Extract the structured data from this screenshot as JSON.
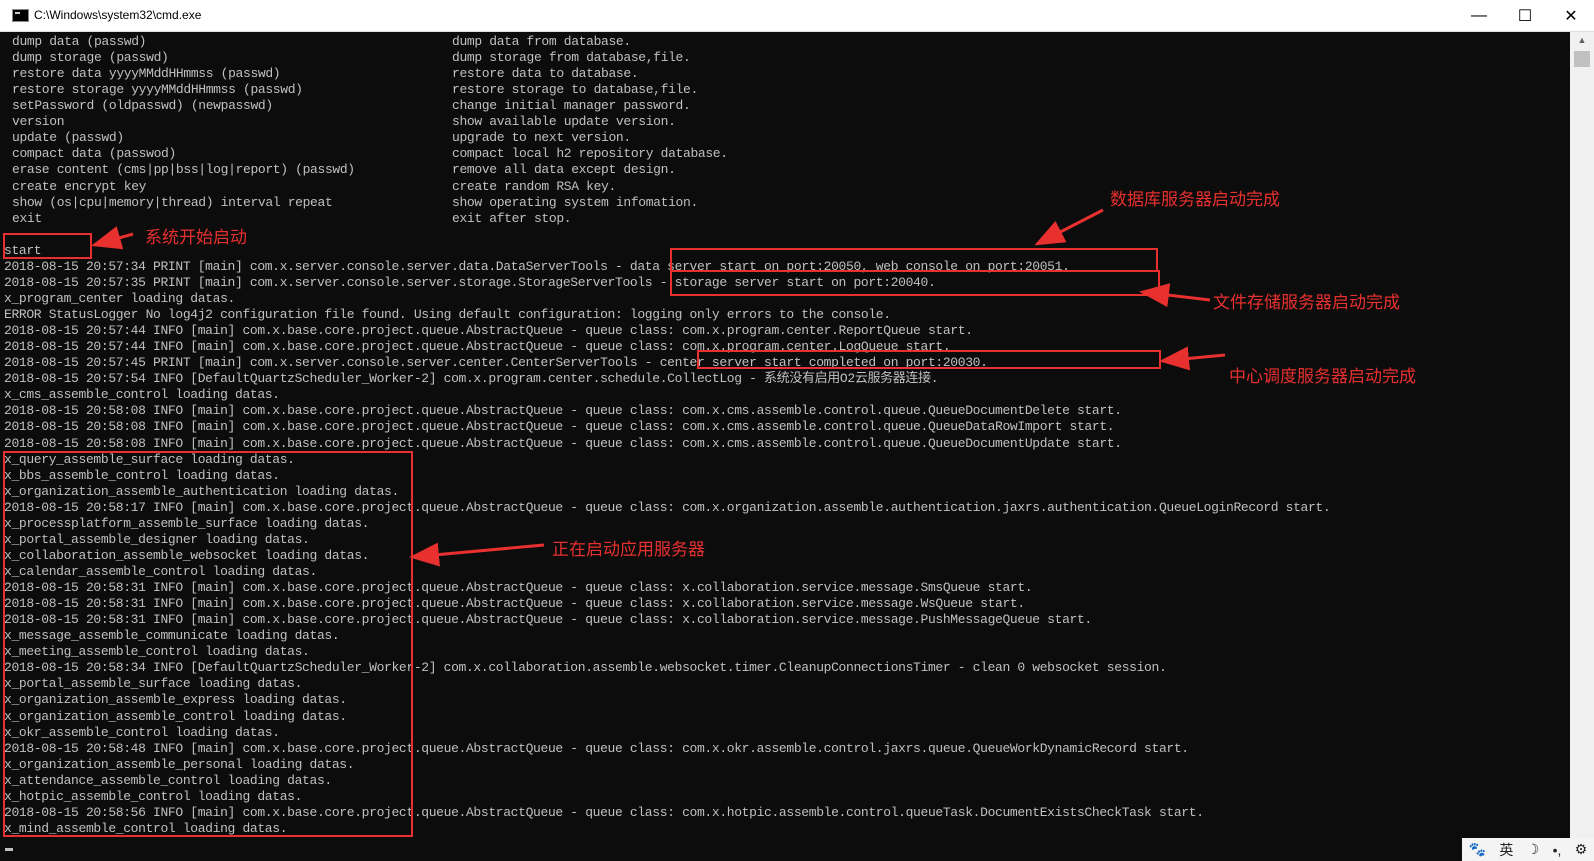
{
  "window": {
    "title": "C:\\Windows\\system32\\cmd.exe",
    "minimize": "—",
    "maximize": "☐",
    "close": "✕"
  },
  "help": [
    [
      "dump data (passwd)",
      "dump data from database."
    ],
    [
      "dump storage (passwd)",
      "dump storage from database,file."
    ],
    [
      "restore data yyyyMMddHHmmss (passwd)",
      "restore data to database."
    ],
    [
      "restore storage yyyyMMddHHmmss (passwd)",
      "restore storage to database,file."
    ],
    [
      "setPassword (oldpasswd) (newpasswd)",
      "change initial manager password."
    ],
    [
      "version",
      "show available update version."
    ],
    [
      "update (passwd)",
      "upgrade to next version."
    ],
    [
      "compact data (passwod)",
      "compact local h2 repository database."
    ],
    [
      "erase content (cms|pp|bss|log|report) (passwd)",
      "remove all data except design."
    ],
    [
      "create encrypt key",
      "create random RSA key."
    ],
    [
      "show (os|cpu|memory|thread) interval repeat",
      "show operating system infomation."
    ],
    [
      "exit",
      "exit after stop."
    ]
  ],
  "command": "start",
  "log": [
    "2018-08-15 20:57:34 PRINT [main] com.x.server.console.server.data.DataServerTools - data server start on port:20050, web console on port:20051.",
    "2018-08-15 20:57:35 PRINT [main] com.x.server.console.server.storage.StorageServerTools - storage server start on port:20040.",
    "x_program_center loading datas.",
    "ERROR StatusLogger No log4j2 configuration file found. Using default configuration: logging only errors to the console.",
    "2018-08-15 20:57:44 INFO [main] com.x.base.core.project.queue.AbstractQueue - queue class: com.x.program.center.ReportQueue start.",
    "2018-08-15 20:57:44 INFO [main] com.x.base.core.project.queue.AbstractQueue - queue class: com.x.program.center.LogQueue start.",
    "2018-08-15 20:57:45 PRINT [main] com.x.server.console.server.center.CenterServerTools - center server start completed on port:20030.",
    "2018-08-15 20:57:54 INFO [DefaultQuartzScheduler_Worker-2] com.x.program.center.schedule.CollectLog - 系统没有启用O2云服务器连接.",
    "x_cms_assemble_control loading datas.",
    "2018-08-15 20:58:08 INFO [main] com.x.base.core.project.queue.AbstractQueue - queue class: com.x.cms.assemble.control.queue.QueueDocumentDelete start.",
    "2018-08-15 20:58:08 INFO [main] com.x.base.core.project.queue.AbstractQueue - queue class: com.x.cms.assemble.control.queue.QueueDataRowImport start.",
    "2018-08-15 20:58:08 INFO [main] com.x.base.core.project.queue.AbstractQueue - queue class: com.x.cms.assemble.control.queue.QueueDocumentUpdate start.",
    "x_query_assemble_surface loading datas.",
    "x_bbs_assemble_control loading datas.",
    "x_organization_assemble_authentication loading datas.",
    "2018-08-15 20:58:17 INFO [main] com.x.base.core.project.queue.AbstractQueue - queue class: com.x.organization.assemble.authentication.jaxrs.authentication.QueueLoginRecord start.",
    "x_processplatform_assemble_surface loading datas.",
    "x_portal_assemble_designer loading datas.",
    "x_collaboration_assemble_websocket loading datas.",
    "x_calendar_assemble_control loading datas.",
    "2018-08-15 20:58:31 INFO [main] com.x.base.core.project.queue.AbstractQueue - queue class: x.collaboration.service.message.SmsQueue start.",
    "2018-08-15 20:58:31 INFO [main] com.x.base.core.project.queue.AbstractQueue - queue class: x.collaboration.service.message.WsQueue start.",
    "2018-08-15 20:58:31 INFO [main] com.x.base.core.project.queue.AbstractQueue - queue class: x.collaboration.service.message.PushMessageQueue start.",
    "x_message_assemble_communicate loading datas.",
    "x_meeting_assemble_control loading datas.",
    "2018-08-15 20:58:34 INFO [DefaultQuartzScheduler_Worker-2] com.x.collaboration.assemble.websocket.timer.CleanupConnectionsTimer - clean 0 websocket session.",
    "x_portal_assemble_surface loading datas.",
    "x_organization_assemble_express loading datas.",
    "x_organization_assemble_control loading datas.",
    "x_okr_assemble_control loading datas.",
    "2018-08-15 20:58:48 INFO [main] com.x.base.core.project.queue.AbstractQueue - queue class: com.x.okr.assemble.control.jaxrs.queue.QueueWorkDynamicRecord start.",
    "x_organization_assemble_personal loading datas.",
    "x_attendance_assemble_control loading datas.",
    "x_hotpic_assemble_control loading datas.",
    "2018-08-15 20:58:56 INFO [main] com.x.base.core.project.queue.AbstractQueue - queue class: com.x.hotpic.assemble.control.queueTask.DocumentExistsCheckTask start.",
    "x_mind_assemble_control loading datas."
  ],
  "annotations": {
    "system_start": "系统开始启动",
    "database_started": "数据库服务器启动完成",
    "storage_started": "文件存储服务器启动完成",
    "center_started": "中心调度服务器启动完成",
    "apps_starting": "正在启动应用服务器"
  },
  "annotation_color": "#e8302f",
  "ime": {
    "logo": "paw-icon",
    "lang": "英",
    "moon": "☽",
    "punct": "•,",
    "settings": "⚙"
  },
  "scrollbar": {
    "up": "▲"
  }
}
